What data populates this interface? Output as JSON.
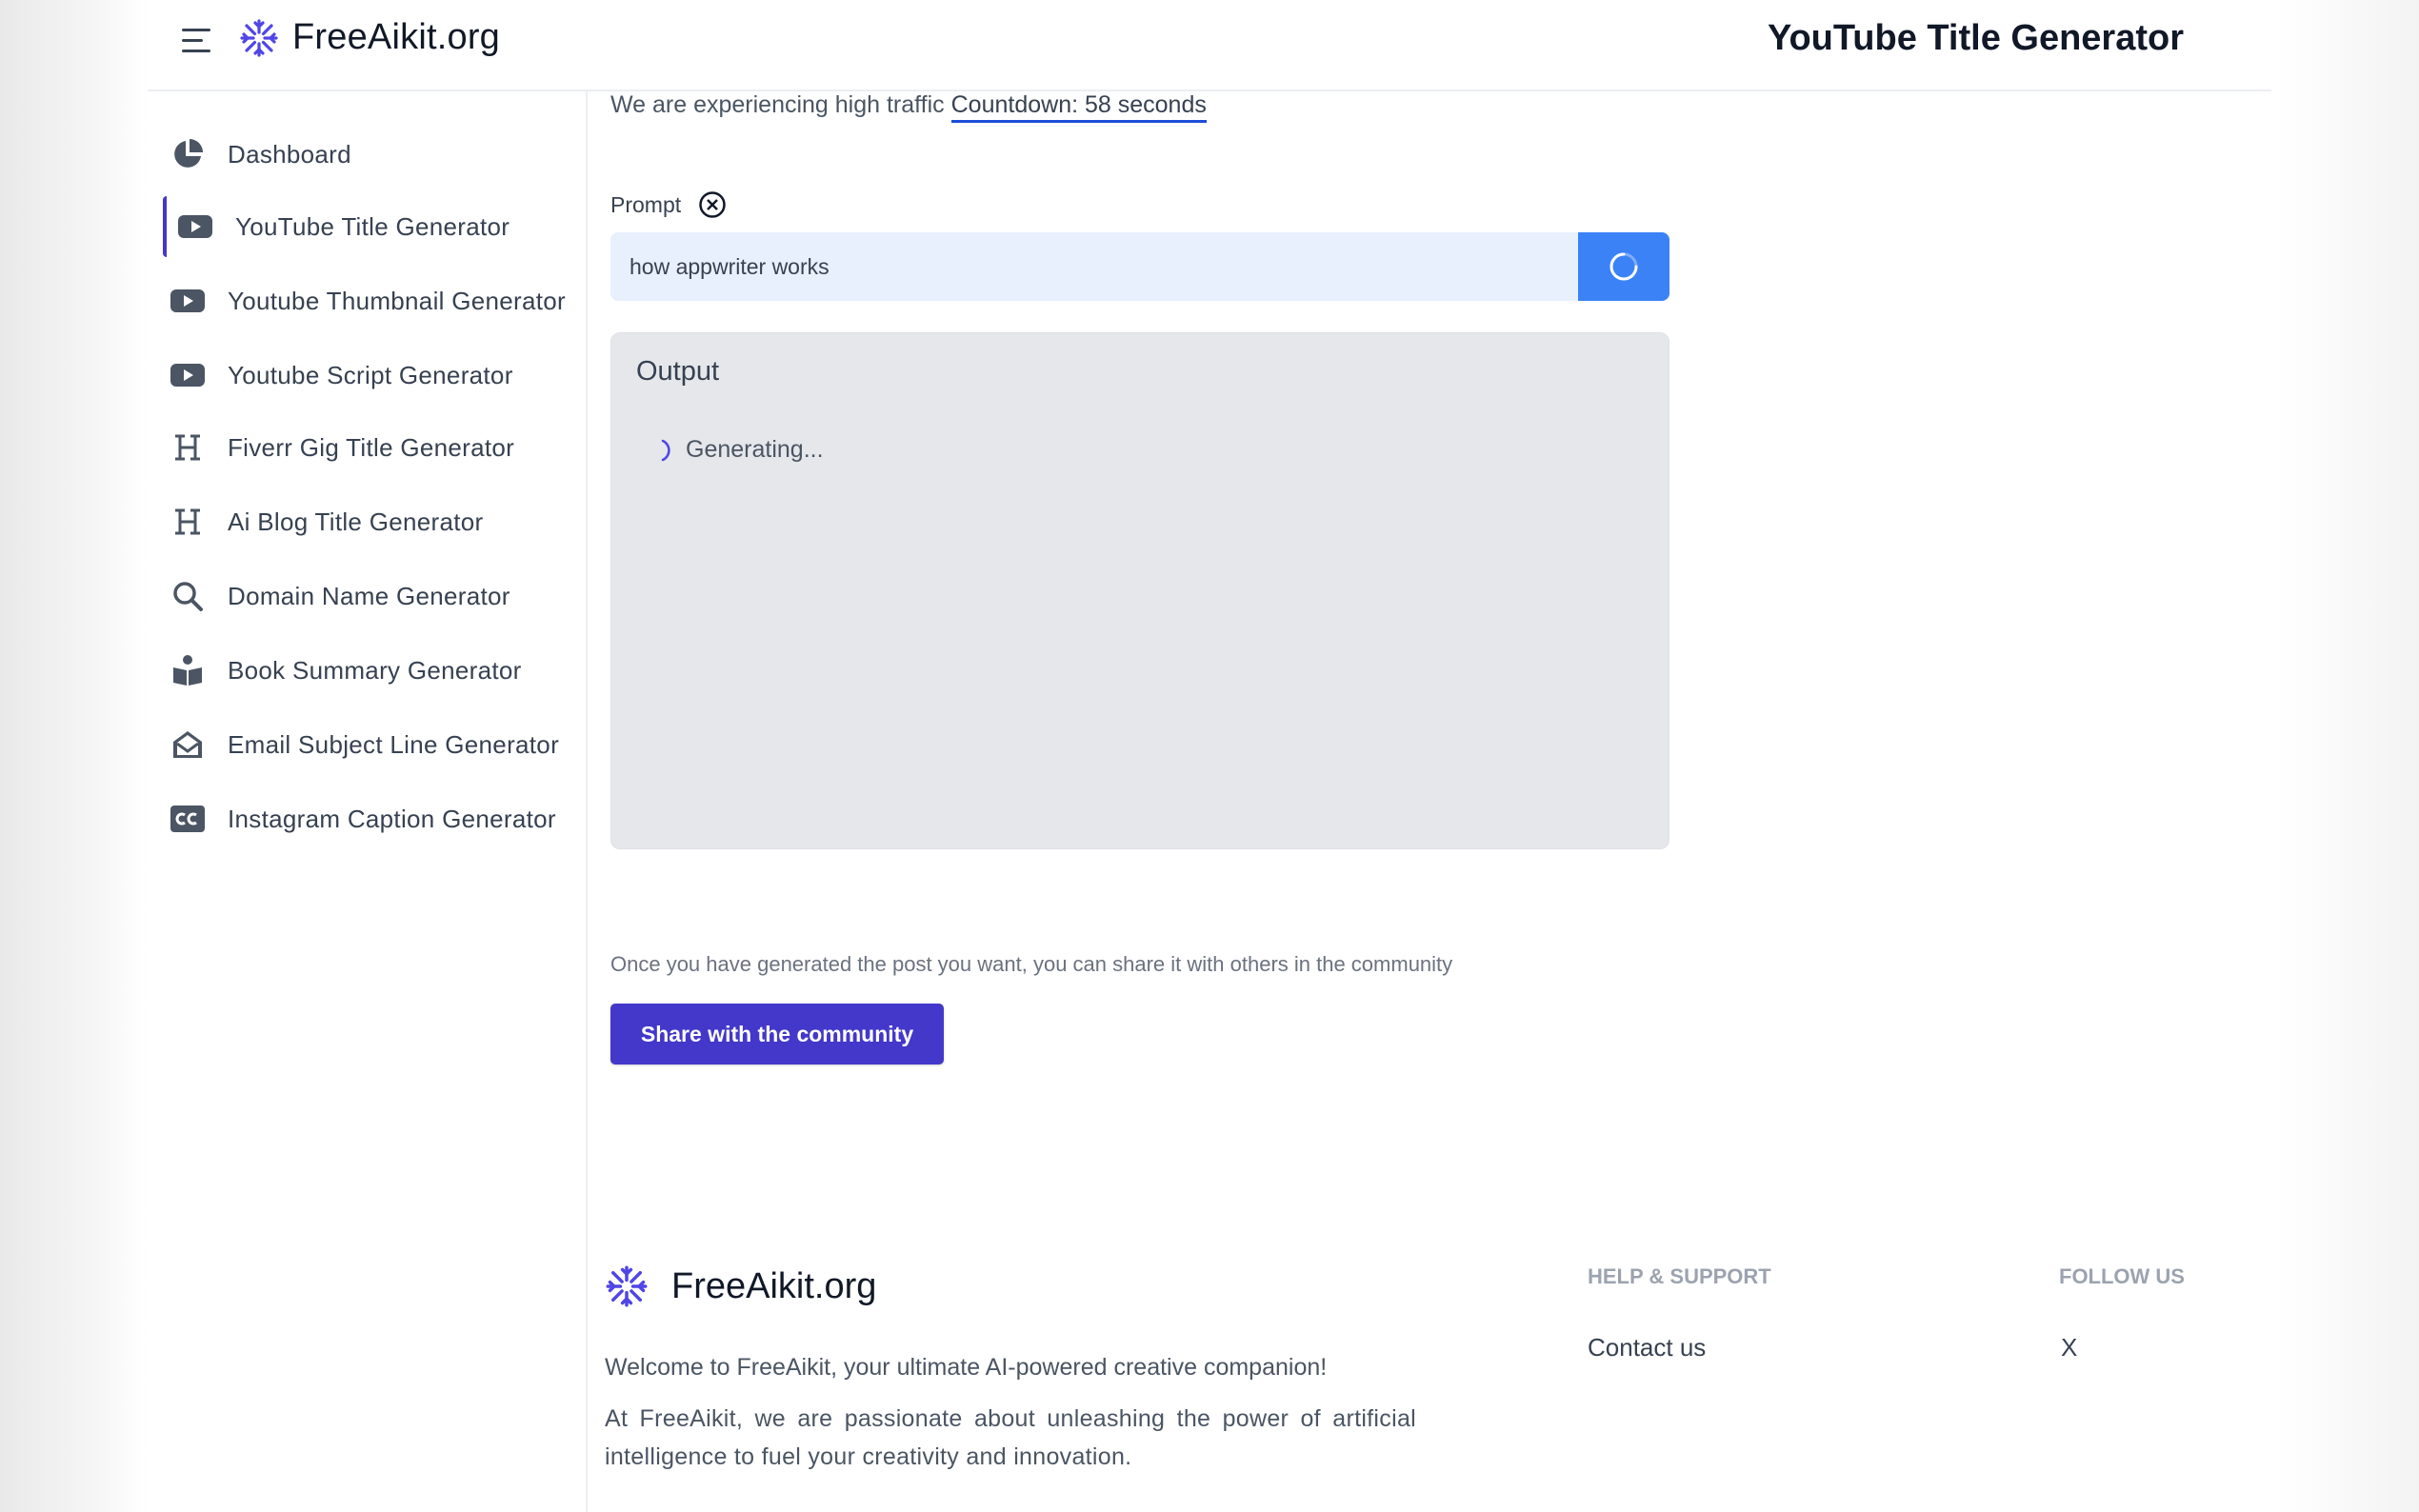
{
  "header": {
    "brand": "FreeAikit.org",
    "page_title": "YouTube Title Generator"
  },
  "sidebar": {
    "items": [
      {
        "label": "Dashboard",
        "icon": "pie-chart-icon"
      },
      {
        "label": "YouTube Title Generator",
        "icon": "youtube-icon",
        "active": true
      },
      {
        "label": "Youtube Thumbnail Generator",
        "icon": "youtube-icon"
      },
      {
        "label": "Youtube Script Generator",
        "icon": "youtube-icon"
      },
      {
        "label": "Fiverr Gig Title Generator",
        "icon": "heading-icon"
      },
      {
        "label": "Ai Blog Title Generator",
        "icon": "heading-icon"
      },
      {
        "label": "Domain Name Generator",
        "icon": "search-icon"
      },
      {
        "label": "Book Summary Generator",
        "icon": "book-reader-icon"
      },
      {
        "label": "Email Subject Line Generator",
        "icon": "envelope-open-icon"
      },
      {
        "label": "Instagram Caption Generator",
        "icon": "closed-captions-icon"
      }
    ]
  },
  "main": {
    "traffic_notice": "We are experiencing high traffic",
    "countdown": "Countdown: 58 seconds",
    "prompt_label": "Prompt",
    "prompt_value": "how appwriter works",
    "output_title": "Output",
    "generating_text": "Generating...",
    "share_text": "Once you have generated the post you want, you can share it with others in the community",
    "share_button": "Share with the community"
  },
  "footer": {
    "brand": "FreeAikit.org",
    "welcome": "Welcome to FreeAikit, your ultimate AI-powered creative companion!",
    "about": "At FreeAikit, we are passionate about unleashing the power of artificial intelligence to fuel your creativity and innovation.",
    "help_heading": "HELP & SUPPORT",
    "follow_heading": "FOLLOW US",
    "contact_link": "Contact us",
    "x_link": "X"
  },
  "colors": {
    "accent": "#4338ca",
    "brand_logo": "#4f46e5",
    "generate_button": "#3b82f6",
    "prompt_bg": "#e8f0fd",
    "output_bg": "#e5e7eb"
  }
}
